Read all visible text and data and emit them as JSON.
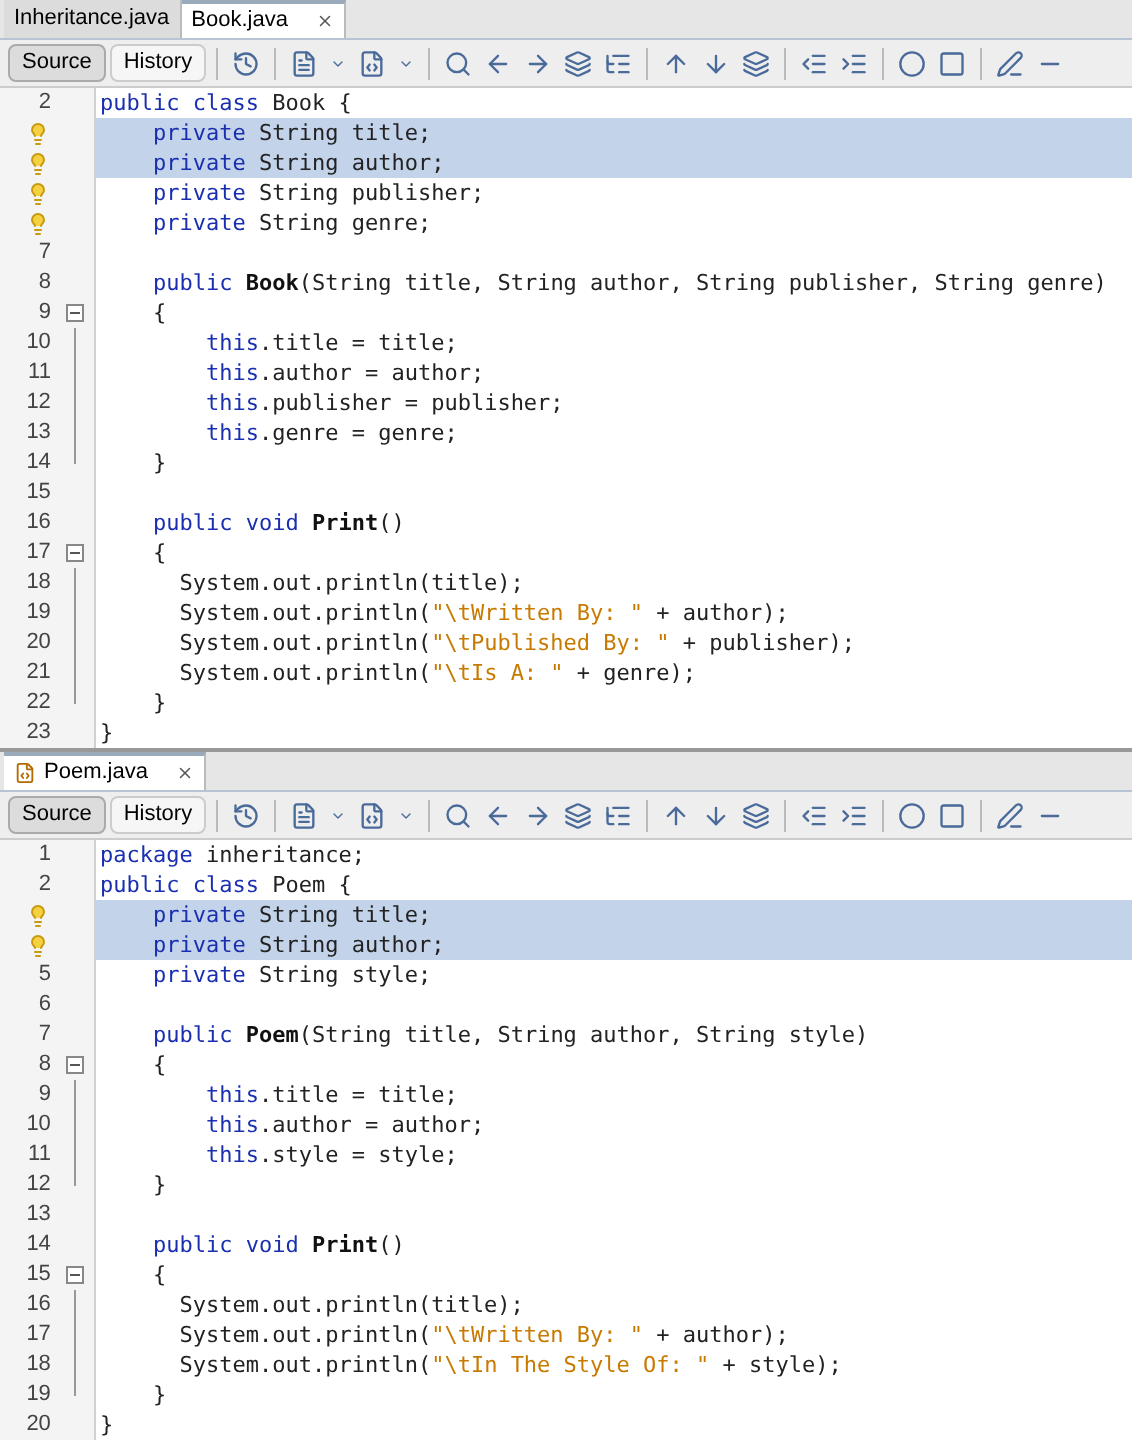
{
  "panes": [
    {
      "tabs": [
        {
          "label": "Inheritance.java",
          "selected": false,
          "closable": false,
          "file_icon": false
        },
        {
          "label": "Book.java",
          "selected": true,
          "closable": true,
          "file_icon": false
        }
      ],
      "view_tabs": [
        {
          "label": "Source",
          "selected": true
        },
        {
          "label": "History",
          "selected": false
        }
      ],
      "lines": [
        {
          "n": "2",
          "kind": "plain",
          "code": [
            {
              "kind": "keyword",
              "text": "public class"
            },
            {
              "kind": "plain",
              "text": " Book {"
            }
          ]
        },
        {
          "kind": "bulb",
          "highlighted": true,
          "code": [
            {
              "kind": "keyword",
              "text": "    private"
            },
            {
              "kind": "plain",
              "text": " String title;"
            }
          ]
        },
        {
          "kind": "bulb",
          "highlighted": true,
          "code": [
            {
              "kind": "keyword",
              "text": "    private"
            },
            {
              "kind": "plain",
              "text": " String author;"
            }
          ]
        },
        {
          "kind": "bulb",
          "code": [
            {
              "kind": "keyword",
              "text": "    private"
            },
            {
              "kind": "plain",
              "text": " String publisher;"
            }
          ]
        },
        {
          "kind": "bulb",
          "code": [
            {
              "kind": "keyword",
              "text": "    private"
            },
            {
              "kind": "plain",
              "text": " String genre;"
            }
          ]
        },
        {
          "n": "7",
          "kind": "plain"
        },
        {
          "n": "8",
          "kind": "plain",
          "code": [
            {
              "kind": "keyword",
              "text": "    public"
            },
            {
              "kind": "method",
              "text": " Book"
            },
            {
              "kind": "plain",
              "text": "(String title, String author, String publisher, String genre)"
            }
          ]
        },
        {
          "n": "9",
          "kind": "fold",
          "code": [
            {
              "kind": "plain",
              "text": "    {"
            }
          ]
        },
        {
          "n": "10",
          "kind": "fold-line",
          "code": [
            {
              "kind": "keyword",
              "text": "        this"
            },
            {
              "kind": "plain",
              "text": ".title = title;"
            }
          ]
        },
        {
          "n": "11",
          "kind": "fold-line",
          "code": [
            {
              "kind": "keyword",
              "text": "        this"
            },
            {
              "kind": "plain",
              "text": ".author = author;"
            }
          ]
        },
        {
          "n": "12",
          "kind": "fold-line",
          "code": [
            {
              "kind": "keyword",
              "text": "        this"
            },
            {
              "kind": "plain",
              "text": ".publisher = publisher;"
            }
          ]
        },
        {
          "n": "13",
          "kind": "fold-line",
          "code": [
            {
              "kind": "keyword",
              "text": "        this"
            },
            {
              "kind": "plain",
              "text": ".genre = genre;"
            }
          ]
        },
        {
          "n": "14",
          "kind": "fold-end",
          "code": [
            {
              "kind": "plain",
              "text": "    }"
            }
          ]
        },
        {
          "n": "15",
          "kind": "plain"
        },
        {
          "n": "16",
          "kind": "plain",
          "code": [
            {
              "kind": "keyword",
              "text": "    public void"
            },
            {
              "kind": "method",
              "text": " Print"
            },
            {
              "kind": "plain",
              "text": "()"
            }
          ]
        },
        {
          "n": "17",
          "kind": "fold",
          "code": [
            {
              "kind": "plain",
              "text": "    {"
            }
          ]
        },
        {
          "n": "18",
          "kind": "fold-line",
          "code": [
            {
              "kind": "plain",
              "text": "      System.out.println(title);"
            }
          ]
        },
        {
          "n": "19",
          "kind": "fold-line",
          "code": [
            {
              "kind": "plain",
              "text": "      System.out.println("
            },
            {
              "kind": "string",
              "text": "\"\\tWritten By: \""
            },
            {
              "kind": "plain",
              "text": " + author);"
            }
          ]
        },
        {
          "n": "20",
          "kind": "fold-line",
          "code": [
            {
              "kind": "plain",
              "text": "      System.out.println("
            },
            {
              "kind": "string",
              "text": "\"\\tPublished By: \""
            },
            {
              "kind": "plain",
              "text": " + publisher);"
            }
          ]
        },
        {
          "n": "21",
          "kind": "fold-line",
          "code": [
            {
              "kind": "plain",
              "text": "      System.out.println("
            },
            {
              "kind": "string",
              "text": "\"\\tIs A: \""
            },
            {
              "kind": "plain",
              "text": " + genre);"
            }
          ]
        },
        {
          "n": "22",
          "kind": "fold-end",
          "code": [
            {
              "kind": "plain",
              "text": "    }"
            }
          ]
        },
        {
          "n": "23",
          "kind": "plain",
          "code": [
            {
              "kind": "plain",
              "text": "}"
            }
          ]
        }
      ]
    },
    {
      "tabs": [
        {
          "label": "Poem.java",
          "selected": true,
          "closable": true,
          "file_icon": true
        }
      ],
      "view_tabs": [
        {
          "label": "Source",
          "selected": true
        },
        {
          "label": "History",
          "selected": false
        }
      ],
      "lines": [
        {
          "n": "1",
          "kind": "plain",
          "code": [
            {
              "kind": "keyword",
              "text": "package"
            },
            {
              "kind": "plain",
              "text": " inheritance;"
            }
          ]
        },
        {
          "n": "2",
          "kind": "plain",
          "code": [
            {
              "kind": "keyword",
              "text": "public class"
            },
            {
              "kind": "plain",
              "text": " Poem {"
            }
          ]
        },
        {
          "kind": "bulb",
          "highlighted": true,
          "code": [
            {
              "kind": "keyword",
              "text": "    private"
            },
            {
              "kind": "plain",
              "text": " String title;"
            }
          ]
        },
        {
          "kind": "bulb",
          "highlighted": true,
          "code": [
            {
              "kind": "keyword",
              "text": "    private"
            },
            {
              "kind": "plain",
              "text": " String author;"
            }
          ]
        },
        {
          "n": "5",
          "kind": "plain",
          "code": [
            {
              "kind": "keyword",
              "text": "    private"
            },
            {
              "kind": "plain",
              "text": " String style;"
            }
          ]
        },
        {
          "n": "6",
          "kind": "plain"
        },
        {
          "n": "7",
          "kind": "plain",
          "code": [
            {
              "kind": "keyword",
              "text": "    public"
            },
            {
              "kind": "method",
              "text": " Poem"
            },
            {
              "kind": "plain",
              "text": "(String title, String author, String style)"
            }
          ]
        },
        {
          "n": "8",
          "kind": "fold",
          "code": [
            {
              "kind": "plain",
              "text": "    {"
            }
          ]
        },
        {
          "n": "9",
          "kind": "fold-line",
          "code": [
            {
              "kind": "keyword",
              "text": "        this"
            },
            {
              "kind": "plain",
              "text": ".title = title;"
            }
          ]
        },
        {
          "n": "10",
          "kind": "fold-line",
          "code": [
            {
              "kind": "keyword",
              "text": "        this"
            },
            {
              "kind": "plain",
              "text": ".author = author;"
            }
          ]
        },
        {
          "n": "11",
          "kind": "fold-line",
          "code": [
            {
              "kind": "keyword",
              "text": "        this"
            },
            {
              "kind": "plain",
              "text": ".style = style;"
            }
          ]
        },
        {
          "n": "12",
          "kind": "fold-end",
          "code": [
            {
              "kind": "plain",
              "text": "    }"
            }
          ]
        },
        {
          "n": "13",
          "kind": "plain"
        },
        {
          "n": "14",
          "kind": "plain",
          "code": [
            {
              "kind": "keyword",
              "text": "    public void"
            },
            {
              "kind": "method",
              "text": " Print"
            },
            {
              "kind": "plain",
              "text": "()"
            }
          ]
        },
        {
          "n": "15",
          "kind": "fold",
          "code": [
            {
              "kind": "plain",
              "text": "    {"
            }
          ]
        },
        {
          "n": "16",
          "kind": "fold-line",
          "code": [
            {
              "kind": "plain",
              "text": "      System.out.println(title);"
            }
          ]
        },
        {
          "n": "17",
          "kind": "fold-line",
          "code": [
            {
              "kind": "plain",
              "text": "      System.out.println("
            },
            {
              "kind": "string",
              "text": "\"\\tWritten By: \""
            },
            {
              "kind": "plain",
              "text": " + author);"
            }
          ]
        },
        {
          "n": "18",
          "kind": "fold-line",
          "code": [
            {
              "kind": "plain",
              "text": "      System.out.println("
            },
            {
              "kind": "string",
              "text": "\"\\tIn The Style Of: \""
            },
            {
              "kind": "plain",
              "text": " + style);"
            }
          ]
        },
        {
          "n": "19",
          "kind": "fold-end",
          "code": [
            {
              "kind": "plain",
              "text": "    }"
            }
          ]
        },
        {
          "n": "20",
          "kind": "plain",
          "code": [
            {
              "kind": "plain",
              "text": "}"
            }
          ]
        }
      ]
    }
  ]
}
